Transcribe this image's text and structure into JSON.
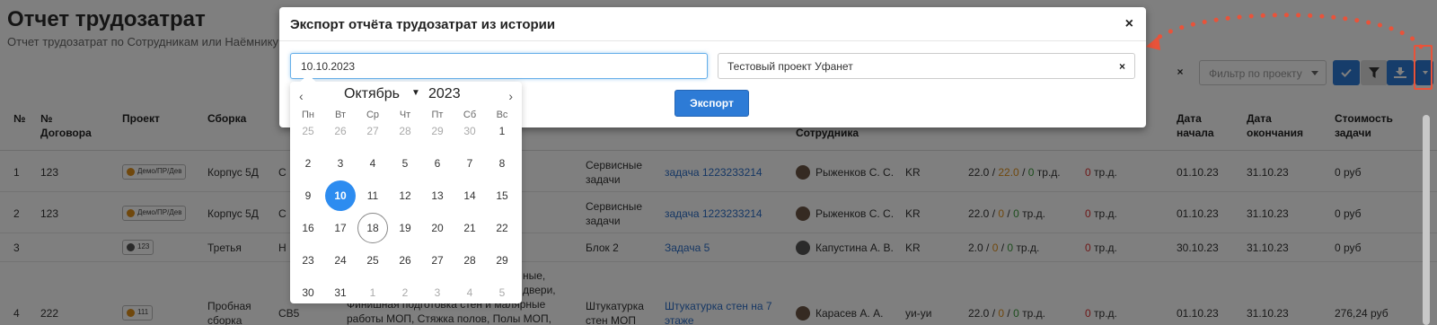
{
  "page": {
    "title": "Отчет трудозатрат",
    "subtitle": "Отчет трудозатрат по Сотрудникам или Наёмнику"
  },
  "toolbar": {
    "clear_label": "×",
    "project_filter_placeholder": "Фильтр по проекту"
  },
  "table": {
    "headers": {
      "num": "№",
      "contract": "№ Договора",
      "project": "Проект",
      "assembly": "Сборка",
      "employee": "Сотрудника",
      "start": "Дата начала",
      "end": "Дата окончания",
      "cost": "Стоимость задачи"
    },
    "rows": [
      {
        "num": "1",
        "contract": "123",
        "tag": "Демо/ПР/Дев",
        "assembly": "Корпус 5Д",
        "code": "С",
        "category": "Сервисные задачи",
        "task": "задача 1223233214",
        "employee": "Рыженков С. С.",
        "country": "KR",
        "hours_a": "22.0",
        "hours_b": "22.0",
        "hours_c": "0",
        "hours_unit": "тр.д.",
        "red_val": "0",
        "red_unit": "тр.д.",
        "start": "01.10.23",
        "end": "31.10.23",
        "cost": "0 руб"
      },
      {
        "num": "2",
        "contract": "123",
        "tag": "Демо/ПР/Дев",
        "assembly": "Корпус 5Д",
        "code": "С",
        "category": "Сервисные задачи",
        "task": "задача 1223233214",
        "employee": "Рыженков С. С.",
        "country": "KR",
        "hours_a": "22.0",
        "hours_b": "0",
        "hours_c": "0",
        "hours_unit": "тр.д.",
        "red_val": "0",
        "red_unit": "тр.д.",
        "start": "01.10.23",
        "end": "31.10.23",
        "cost": "0 руб"
      },
      {
        "num": "3",
        "contract": "",
        "tag": "123",
        "assembly": "Третья",
        "code": "Н",
        "category": "Блок 2",
        "task": "Задача 5",
        "employee": "Капустина А. В.",
        "country": "KR",
        "hours_a": "2.0",
        "hours_b": "0",
        "hours_c": "0",
        "hours_unit": "тр.д.",
        "red_val": "0",
        "red_unit": "тр.д.",
        "start": "30.10.23",
        "end": "31.10.23",
        "cost": "0 руб"
      },
      {
        "num": "4",
        "contract": "222",
        "tag": "111",
        "assembly": "Пробная сборка",
        "code": "СВ5",
        "desc_lines": [
          "ные,",
          "двери,",
          "Финишная подготовка стен и малярные",
          "работы МОП, Стяжка полов, Полы МОП,"
        ],
        "category": "Штукатурка стен МОП",
        "task": "Штукатурка стен на 7 этаже",
        "employee": "Карасев А. А.",
        "country": "уи-уи",
        "hours_a": "22.0",
        "hours_b": "0",
        "hours_c": "0",
        "hours_unit": "тр.д.",
        "red_val": "0",
        "red_unit": "тр.д.",
        "start": "01.10.23",
        "end": "31.10.23",
        "cost": "276,24 руб"
      }
    ]
  },
  "modal": {
    "title": "Экспорт отчёта трудозатрат из истории",
    "close_label": "×",
    "date_value": "10.10.2023",
    "project_value": "Тестовый проект Уфанет",
    "project_clear": "×",
    "export_label": "Экспорт"
  },
  "calendar": {
    "month": "Октябрь",
    "year": "2023",
    "prev": "‹",
    "next": "›",
    "weekdays": [
      "Пн",
      "Вт",
      "Ср",
      "Чт",
      "Пт",
      "Сб",
      "Вс"
    ],
    "weeks": [
      [
        "25",
        "26",
        "27",
        "28",
        "29",
        "30",
        "1"
      ],
      [
        "2",
        "3",
        "4",
        "5",
        "6",
        "7",
        "8"
      ],
      [
        "9",
        "10",
        "11",
        "12",
        "13",
        "14",
        "15"
      ],
      [
        "16",
        "17",
        "18",
        "19",
        "20",
        "21",
        "22"
      ],
      [
        "23",
        "24",
        "25",
        "26",
        "27",
        "28",
        "29"
      ],
      [
        "30",
        "31",
        "1",
        "2",
        "3",
        "4",
        "5"
      ]
    ],
    "selected_day": "10",
    "today_day": "18"
  },
  "colors": {
    "primary": "#2d7bd6",
    "selected": "#2d8cf0",
    "highlight": "#e8533a"
  }
}
